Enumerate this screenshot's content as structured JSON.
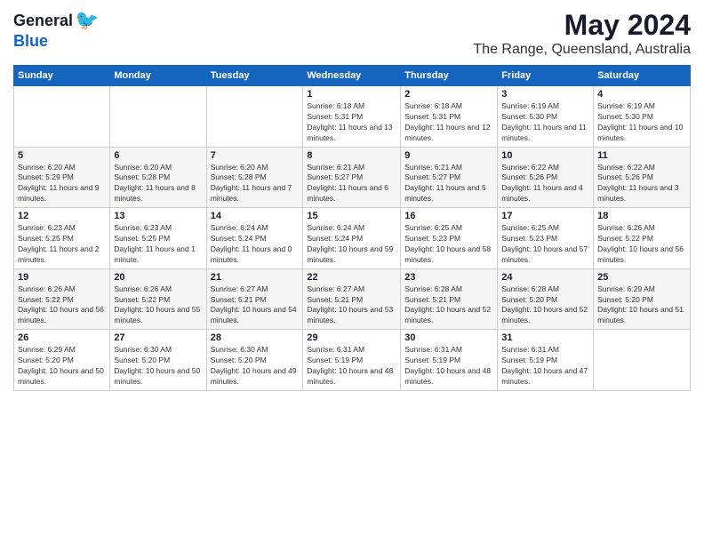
{
  "logo": {
    "general": "General",
    "blue": "Blue"
  },
  "title": "May 2024",
  "location": "The Range, Queensland, Australia",
  "weekdays": [
    "Sunday",
    "Monday",
    "Tuesday",
    "Wednesday",
    "Thursday",
    "Friday",
    "Saturday"
  ],
  "weeks": [
    [
      {
        "day": "",
        "info": ""
      },
      {
        "day": "",
        "info": ""
      },
      {
        "day": "",
        "info": ""
      },
      {
        "day": "1",
        "info": "Sunrise: 6:18 AM\nSunset: 5:31 PM\nDaylight: 11 hours and 13 minutes."
      },
      {
        "day": "2",
        "info": "Sunrise: 6:18 AM\nSunset: 5:31 PM\nDaylight: 11 hours and 12 minutes."
      },
      {
        "day": "3",
        "info": "Sunrise: 6:19 AM\nSunset: 5:30 PM\nDaylight: 11 hours and 11 minutes."
      },
      {
        "day": "4",
        "info": "Sunrise: 6:19 AM\nSunset: 5:30 PM\nDaylight: 11 hours and 10 minutes."
      }
    ],
    [
      {
        "day": "5",
        "info": "Sunrise: 6:20 AM\nSunset: 5:29 PM\nDaylight: 11 hours and 9 minutes."
      },
      {
        "day": "6",
        "info": "Sunrise: 6:20 AM\nSunset: 5:28 PM\nDaylight: 11 hours and 8 minutes."
      },
      {
        "day": "7",
        "info": "Sunrise: 6:20 AM\nSunset: 5:28 PM\nDaylight: 11 hours and 7 minutes."
      },
      {
        "day": "8",
        "info": "Sunrise: 6:21 AM\nSunset: 5:27 PM\nDaylight: 11 hours and 6 minutes."
      },
      {
        "day": "9",
        "info": "Sunrise: 6:21 AM\nSunset: 5:27 PM\nDaylight: 11 hours and 5 minutes."
      },
      {
        "day": "10",
        "info": "Sunrise: 6:22 AM\nSunset: 5:26 PM\nDaylight: 11 hours and 4 minutes."
      },
      {
        "day": "11",
        "info": "Sunrise: 6:22 AM\nSunset: 5:26 PM\nDaylight: 11 hours and 3 minutes."
      }
    ],
    [
      {
        "day": "12",
        "info": "Sunrise: 6:23 AM\nSunset: 5:25 PM\nDaylight: 11 hours and 2 minutes."
      },
      {
        "day": "13",
        "info": "Sunrise: 6:23 AM\nSunset: 5:25 PM\nDaylight: 11 hours and 1 minute."
      },
      {
        "day": "14",
        "info": "Sunrise: 6:24 AM\nSunset: 5:24 PM\nDaylight: 11 hours and 0 minutes."
      },
      {
        "day": "15",
        "info": "Sunrise: 6:24 AM\nSunset: 5:24 PM\nDaylight: 10 hours and 59 minutes."
      },
      {
        "day": "16",
        "info": "Sunrise: 6:25 AM\nSunset: 5:23 PM\nDaylight: 10 hours and 58 minutes."
      },
      {
        "day": "17",
        "info": "Sunrise: 6:25 AM\nSunset: 5:23 PM\nDaylight: 10 hours and 57 minutes."
      },
      {
        "day": "18",
        "info": "Sunrise: 6:26 AM\nSunset: 5:22 PM\nDaylight: 10 hours and 56 minutes."
      }
    ],
    [
      {
        "day": "19",
        "info": "Sunrise: 6:26 AM\nSunset: 5:22 PM\nDaylight: 10 hours and 56 minutes."
      },
      {
        "day": "20",
        "info": "Sunrise: 6:26 AM\nSunset: 5:22 PM\nDaylight: 10 hours and 55 minutes."
      },
      {
        "day": "21",
        "info": "Sunrise: 6:27 AM\nSunset: 5:21 PM\nDaylight: 10 hours and 54 minutes."
      },
      {
        "day": "22",
        "info": "Sunrise: 6:27 AM\nSunset: 5:21 PM\nDaylight: 10 hours and 53 minutes."
      },
      {
        "day": "23",
        "info": "Sunrise: 6:28 AM\nSunset: 5:21 PM\nDaylight: 10 hours and 52 minutes."
      },
      {
        "day": "24",
        "info": "Sunrise: 6:28 AM\nSunset: 5:20 PM\nDaylight: 10 hours and 52 minutes."
      },
      {
        "day": "25",
        "info": "Sunrise: 6:29 AM\nSunset: 5:20 PM\nDaylight: 10 hours and 51 minutes."
      }
    ],
    [
      {
        "day": "26",
        "info": "Sunrise: 6:29 AM\nSunset: 5:20 PM\nDaylight: 10 hours and 50 minutes."
      },
      {
        "day": "27",
        "info": "Sunrise: 6:30 AM\nSunset: 5:20 PM\nDaylight: 10 hours and 50 minutes."
      },
      {
        "day": "28",
        "info": "Sunrise: 6:30 AM\nSunset: 5:20 PM\nDaylight: 10 hours and 49 minutes."
      },
      {
        "day": "29",
        "info": "Sunrise: 6:31 AM\nSunset: 5:19 PM\nDaylight: 10 hours and 48 minutes."
      },
      {
        "day": "30",
        "info": "Sunrise: 6:31 AM\nSunset: 5:19 PM\nDaylight: 10 hours and 48 minutes."
      },
      {
        "day": "31",
        "info": "Sunrise: 6:31 AM\nSunset: 5:19 PM\nDaylight: 10 hours and 47 minutes."
      },
      {
        "day": "",
        "info": ""
      }
    ]
  ]
}
